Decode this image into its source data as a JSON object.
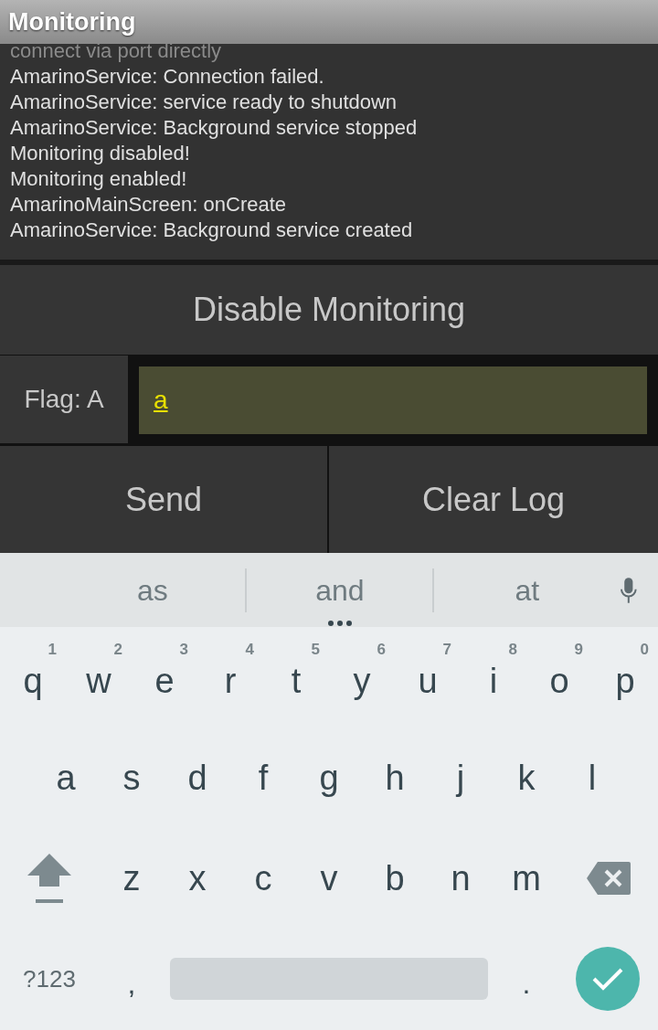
{
  "title": "Monitoring",
  "log": [
    "connect via port directly",
    "AmarinoService: Connection failed.",
    "AmarinoService: service ready to shutdown",
    "AmarinoService: Background service stopped",
    "Monitoring disabled!",
    "Monitoring enabled!",
    "AmarinoMainScreen: onCreate",
    "AmarinoService: Background service created"
  ],
  "toggle_button": "Disable Monitoring",
  "flag_label": "Flag: A",
  "flag_field": {
    "value": "a"
  },
  "buttons": [
    "Send",
    "Clear Log"
  ],
  "keyboard": {
    "suggestions": [
      "as",
      "and",
      "at"
    ],
    "row1": [
      {
        "label": "q",
        "hint": "1"
      },
      {
        "label": "w",
        "hint": "2"
      },
      {
        "label": "e",
        "hint": "3"
      },
      {
        "label": "r",
        "hint": "4"
      },
      {
        "label": "t",
        "hint": "5"
      },
      {
        "label": "y",
        "hint": "6"
      },
      {
        "label": "u",
        "hint": "7"
      },
      {
        "label": "i",
        "hint": "8"
      },
      {
        "label": "o",
        "hint": "9"
      },
      {
        "label": "p",
        "hint": "0"
      }
    ],
    "row2": [
      "a",
      "s",
      "d",
      "f",
      "g",
      "h",
      "j",
      "k",
      "l"
    ],
    "row3": [
      "z",
      "x",
      "c",
      "v",
      "b",
      "n",
      "m"
    ],
    "symbols_key": "?123",
    "comma_key": ",",
    "period_key": "."
  }
}
